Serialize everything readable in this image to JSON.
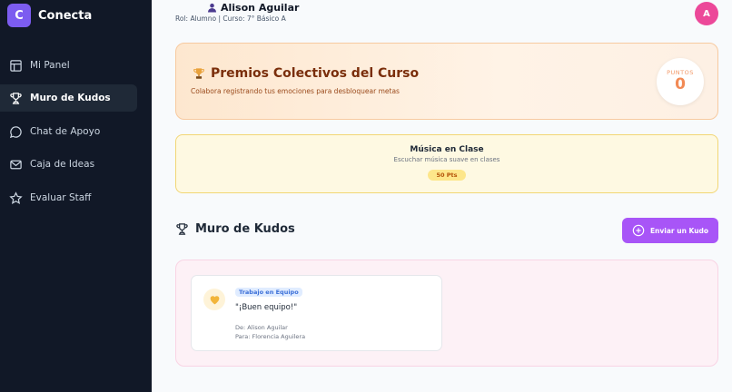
{
  "brand": {
    "logo_letter": "C",
    "name": "Conecta"
  },
  "sidebar": {
    "items": [
      {
        "label": "Mi Panel",
        "icon": "layout-icon",
        "active": false
      },
      {
        "label": "Muro de Kudos",
        "icon": "trophy-icon",
        "active": true
      },
      {
        "label": "Chat de Apoyo",
        "icon": "chat-icon",
        "active": false
      },
      {
        "label": "Caja de Ideas",
        "icon": "mail-icon",
        "active": false
      },
      {
        "label": "Evaluar Staff",
        "icon": "star-icon",
        "active": false
      }
    ]
  },
  "header": {
    "user_name": "Alison Aguilar",
    "user_subtitle": "Rol: Alumno | Curso: 7° Básico A",
    "avatar_letter": "A"
  },
  "premios": {
    "title": "Premios Colectivos del Curso",
    "subtitle": "Colabora registrando tus emociones para desbloquear metas",
    "points_label": "PUNTOS",
    "points_value": "0"
  },
  "goal": {
    "title": "Música en Clase",
    "description": "Escuchar música suave en clases",
    "points": "50 Pts"
  },
  "kudos": {
    "heading": "Muro de Kudos",
    "send_button": "Enviar un Kudo",
    "cards": [
      {
        "tag": "Trabajo en Equipo",
        "message": "\"¡Buen equipo!\"",
        "from": "De: Alison Aguilar",
        "to": "Para: Florencia Aguilera"
      }
    ]
  },
  "colors": {
    "sidebar_bg": "#111827",
    "accent": "#a855f7",
    "avatar": "#ec4899",
    "brand": "#7c5cf0"
  }
}
